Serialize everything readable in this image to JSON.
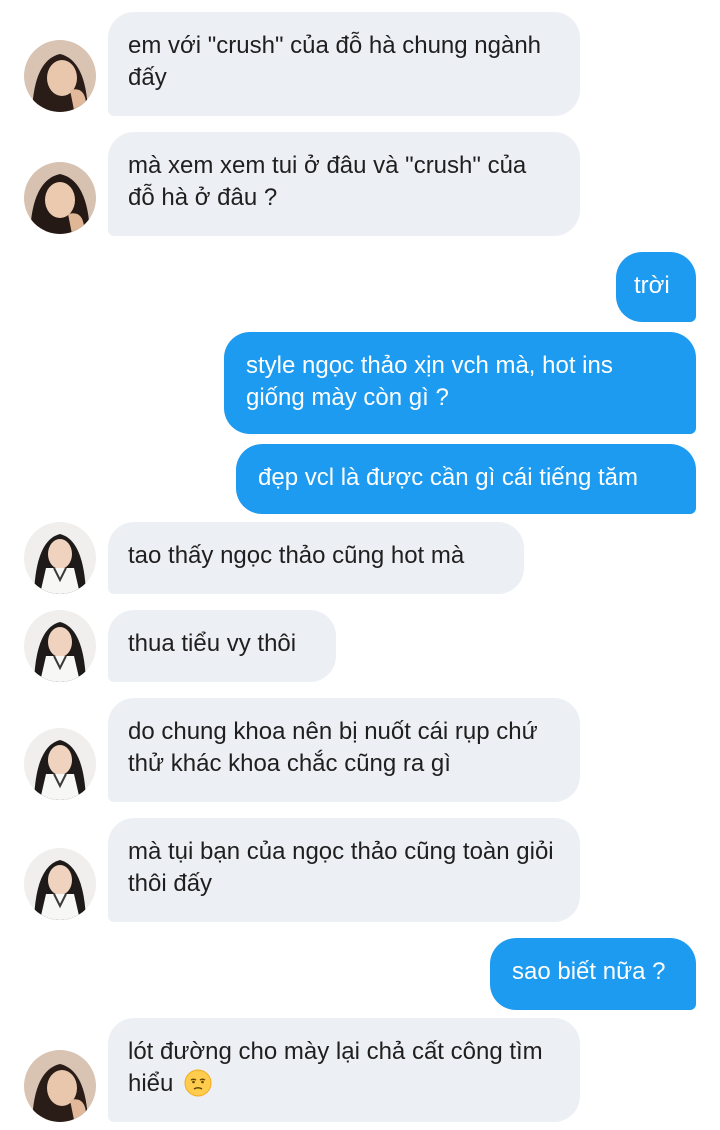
{
  "colors": {
    "incoming_bubble": "#eceff4",
    "outgoing_bubble": "#1d9bf0",
    "outgoing_text": "#ffffff",
    "incoming_text": "#1f1f1f"
  },
  "messages": [
    {
      "direction": "in",
      "avatar": "avatar-user-a",
      "text": "em với \"crush\" của đỗ hà chung ngành đấy"
    },
    {
      "direction": "in",
      "avatar": "avatar-user-a",
      "text": "mà xem xem tui ở đâu và \"crush\" của đỗ hà ở đâu ?"
    },
    {
      "direction": "out",
      "text": "trời"
    },
    {
      "direction": "out",
      "text": "style ngọc thảo xịn vch mà, hot ins giống mày còn gì ?"
    },
    {
      "direction": "out",
      "text": "đẹp vcl là được cần gì cái tiếng tăm"
    },
    {
      "direction": "in",
      "avatar": "avatar-user-b",
      "text": "tao thấy ngọc thảo cũng hot mà"
    },
    {
      "direction": "in",
      "avatar": "avatar-user-b",
      "text": "thua tiểu vy thôi"
    },
    {
      "direction": "in",
      "avatar": "avatar-user-b",
      "text": "do chung khoa nên bị nuốt cái rụp chứ thử khác khoa chắc cũng ra gì"
    },
    {
      "direction": "in",
      "avatar": "avatar-user-b",
      "text": "mà tụi bạn của ngọc thảo cũng toàn giỏi thôi đấy"
    },
    {
      "direction": "out",
      "text": "sao biết nữa ?"
    },
    {
      "direction": "in",
      "avatar": "avatar-user-a",
      "text": "lót đường cho mày lại chả cất công tìm hiểu",
      "emoji": "unamused-face-emoji"
    }
  ]
}
